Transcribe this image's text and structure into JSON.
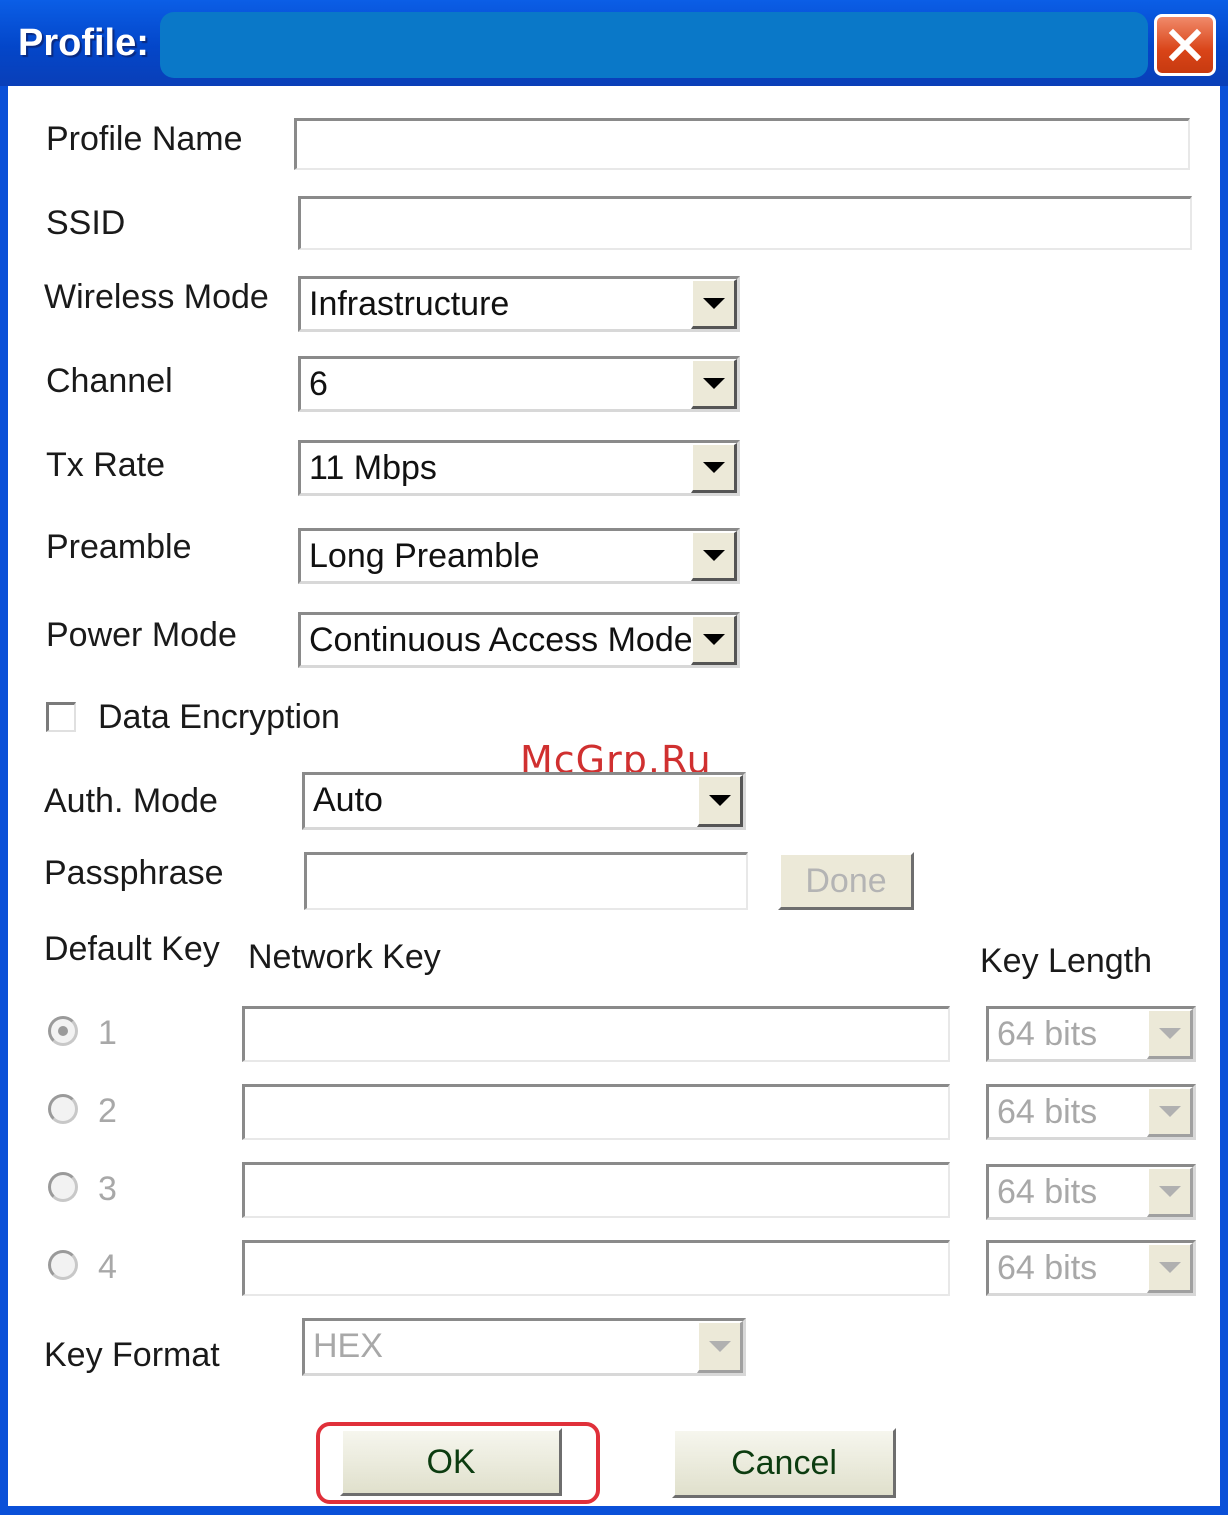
{
  "window": {
    "title": "Profile:",
    "close_label": "✕"
  },
  "form": {
    "profile_name": {
      "label": "Profile Name",
      "value": ""
    },
    "ssid": {
      "label": "SSID",
      "value": ""
    },
    "wireless_mode": {
      "label": "Wireless Mode",
      "value": "Infrastructure"
    },
    "channel": {
      "label": "Channel",
      "value": "6"
    },
    "tx_rate": {
      "label": "Tx Rate",
      "value": "11 Mbps"
    },
    "preamble": {
      "label": "Preamble",
      "value": "Long Preamble"
    },
    "power_mode": {
      "label": "Power Mode",
      "value": "Continuous Access Mode"
    },
    "data_encryption": {
      "label": "Data Encryption",
      "checked": false
    },
    "auth_mode": {
      "label": "Auth. Mode",
      "value": "Auto"
    },
    "passphrase": {
      "label": "Passphrase",
      "value": "",
      "button": "Done"
    },
    "default_key_label": "Default Key",
    "network_key_label": "Network Key",
    "key_length_label": "Key Length",
    "keys": [
      {
        "index": "1",
        "selected": true,
        "key": "",
        "length": "64 bits"
      },
      {
        "index": "2",
        "selected": false,
        "key": "",
        "length": "64 bits"
      },
      {
        "index": "3",
        "selected": false,
        "key": "",
        "length": "64 bits"
      },
      {
        "index": "4",
        "selected": false,
        "key": "",
        "length": "64 bits"
      }
    ],
    "key_format": {
      "label": "Key Format",
      "value": "HEX"
    }
  },
  "buttons": {
    "ok": "OK",
    "cancel": "Cancel"
  },
  "watermark": "McGrp.Ru"
}
